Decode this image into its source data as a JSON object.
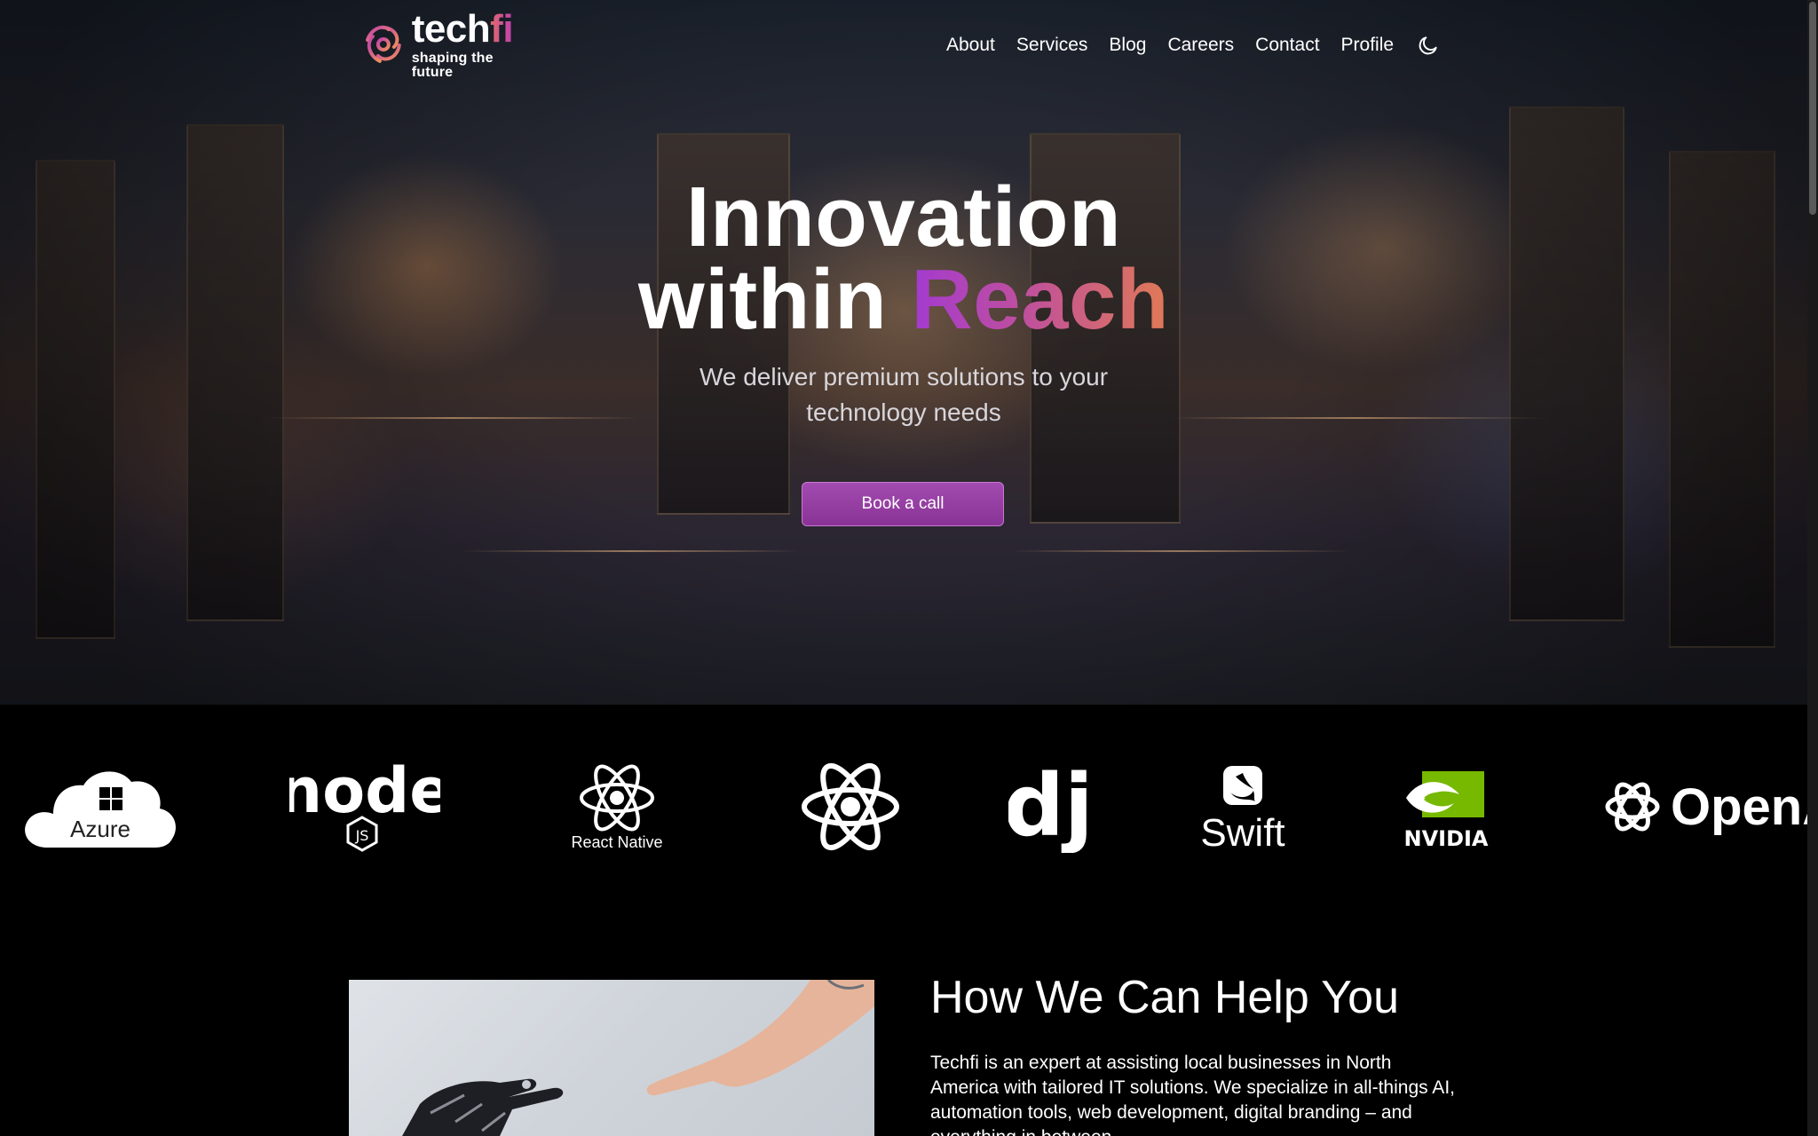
{
  "brand": {
    "name_main": "tech",
    "name_accent": "fi",
    "tagline": "shaping the future",
    "accent_colors": [
      "#e06a6a",
      "#c040b0"
    ]
  },
  "nav": {
    "items": [
      "About",
      "Services",
      "Blog",
      "Careers",
      "Contact",
      "Profile"
    ],
    "theme_toggle_icon": "moon-icon"
  },
  "hero": {
    "title_line1": "Innovation",
    "title_line2_plain": "within",
    "title_line2_accent": "Reach",
    "subtitle": "We deliver premium solutions to your technology needs",
    "cta_label": "Book a call",
    "cta_color": "#9a40aa"
  },
  "tech_logos": [
    {
      "name": "azure-logo",
      "label": "Azure"
    },
    {
      "name": "nodejs-logo",
      "label": "node"
    },
    {
      "name": "react-native-logo",
      "label": "React Native"
    },
    {
      "name": "react-logo",
      "label": ""
    },
    {
      "name": "django-logo",
      "label": "dj"
    },
    {
      "name": "swift-logo",
      "label": "Swift"
    },
    {
      "name": "nvidia-logo",
      "label": "NVIDIA"
    },
    {
      "name": "openai-logo",
      "label": "OpenA"
    }
  ],
  "help": {
    "title": "How We Can Help You",
    "body": "Techfi is an expert at assisting local businesses in North America with tailored IT solutions. We specialize in all-things AI, automation tools, web development, digital branding – and everything in between."
  }
}
